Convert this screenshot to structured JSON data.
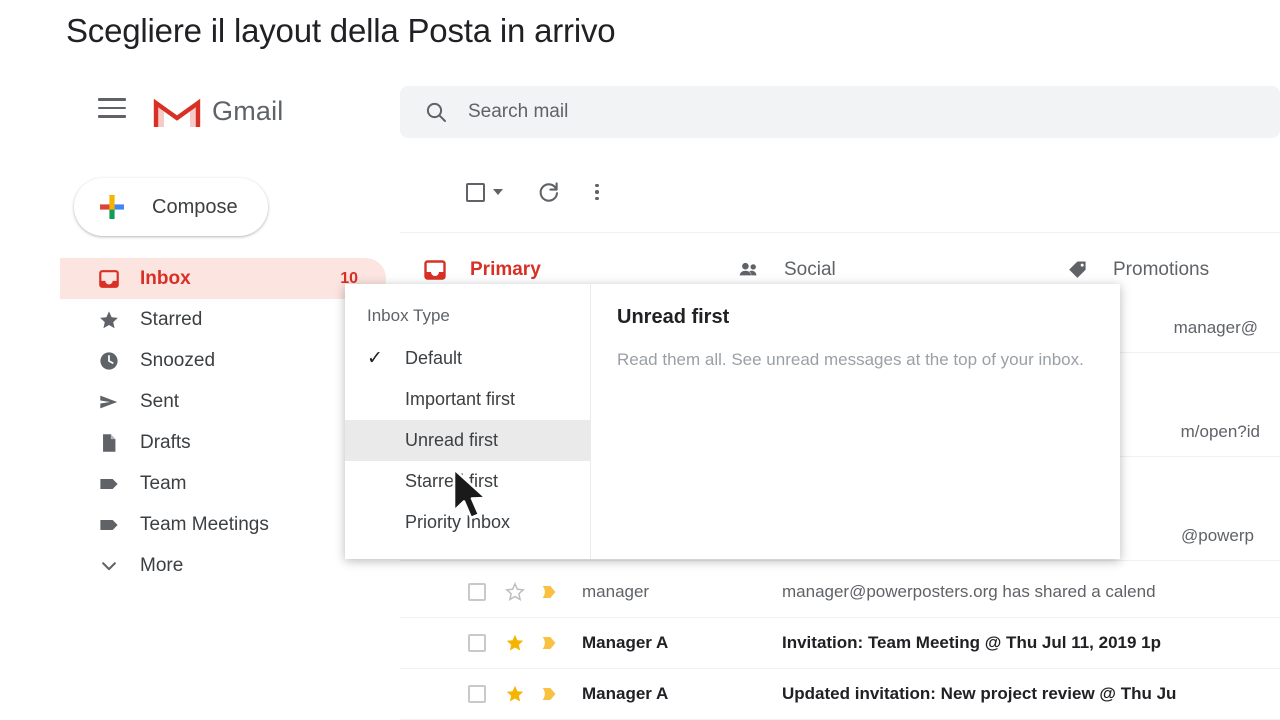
{
  "slide": {
    "title": "Scegliere il layout della Posta in arrivo"
  },
  "header": {
    "menu_icon": "hamburger-icon",
    "logo_icon": "gmail-logo-icon",
    "app_name": "Gmail",
    "search": {
      "icon": "search-icon",
      "placeholder": "Search mail",
      "value": ""
    }
  },
  "sidebar": {
    "compose": {
      "label": "Compose",
      "icon": "plus-icon"
    },
    "items": [
      {
        "label": "Inbox",
        "icon": "inbox-icon",
        "count": "10",
        "active": true
      },
      {
        "label": "Starred",
        "icon": "star-icon",
        "count": "",
        "active": false
      },
      {
        "label": "Snoozed",
        "icon": "clock-icon",
        "count": "",
        "active": false
      },
      {
        "label": "Sent",
        "icon": "send-icon",
        "count": "",
        "active": false
      },
      {
        "label": "Drafts",
        "icon": "document-icon",
        "count": "",
        "active": false
      },
      {
        "label": "Team",
        "icon": "label-tag-icon",
        "count": "",
        "active": false
      },
      {
        "label": "Team Meetings",
        "icon": "label-tag-icon",
        "count": "",
        "active": false
      },
      {
        "label": "More",
        "icon": "chevron-down-icon",
        "count": "",
        "active": false
      }
    ]
  },
  "toolbar": {
    "select_all_icon": "checkbox-icon",
    "select_all_caret_icon": "chevron-down-icon",
    "refresh_icon": "refresh-icon",
    "more_icon": "more-vertical-icon"
  },
  "tabs": [
    {
      "label": "Primary",
      "icon": "inbox-icon",
      "active": true
    },
    {
      "label": "Social",
      "icon": "people-icon",
      "active": false
    },
    {
      "label": "Promotions",
      "icon": "label-tag-icon",
      "active": false
    }
  ],
  "popup": {
    "heading": "Inbox Type",
    "items": [
      {
        "label": "Default",
        "checked": true,
        "hovered": false
      },
      {
        "label": "Important first",
        "checked": false,
        "hovered": false
      },
      {
        "label": "Unread first",
        "checked": false,
        "hovered": true
      },
      {
        "label": "Starred first",
        "checked": false,
        "hovered": false
      },
      {
        "label": "Priority Inbox",
        "checked": false,
        "hovered": false
      }
    ],
    "check_glyph": "✓",
    "detail": {
      "title": "Unread first",
      "body": "Read them all. See unread messages at the top of your inbox."
    }
  },
  "mail": {
    "obscured_rows": [
      {
        "text": "manager@"
      },
      {
        "text": "m/open?id"
      },
      {
        "text": "@powerp"
      }
    ],
    "rows": [
      {
        "sender": "manager",
        "subject": "manager@powerposters.org has shared a calend",
        "starred": false,
        "important": true,
        "read": true
      },
      {
        "sender": "Manager A",
        "subject": "Invitation: Team Meeting @ Thu Jul 11, 2019 1p",
        "starred": true,
        "important": true,
        "read": false
      },
      {
        "sender": "Manager A",
        "subject": "Updated invitation: New project review @ Thu Ju",
        "starred": true,
        "important": true,
        "read": false
      }
    ]
  },
  "colors": {
    "accent_red": "#d93025",
    "active_bg": "#fce4e1",
    "search_bg": "#f1f3f4",
    "icon_gray": "#5f6368",
    "star_yellow": "#f4b400",
    "hover_gray": "#eaeaea"
  },
  "cursor": {
    "icon": "mouse-pointer-icon"
  }
}
